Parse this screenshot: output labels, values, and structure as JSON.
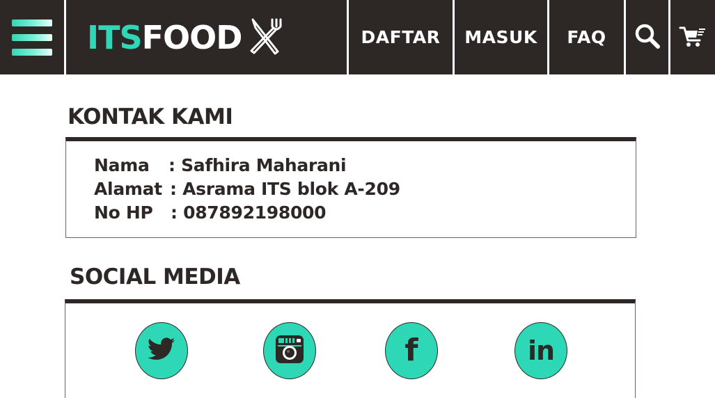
{
  "header": {
    "logo": {
      "part1": "ITS",
      "part2": "FOOD"
    },
    "nav": {
      "register": "DAFTAR",
      "login": "MASUK",
      "faq": "FAQ"
    }
  },
  "contact": {
    "title": "KONTAK KAMI",
    "rows": [
      {
        "label": "Nama",
        "value": ": Safhira Maharani"
      },
      {
        "label": "Alamat",
        "value": ": Asrama ITS blok A-209"
      },
      {
        "label": "No HP",
        "value": ": 087892198000"
      }
    ]
  },
  "social": {
    "title": "SOCIAL MEDIA",
    "facebook_glyph": "f",
    "linkedin_glyph": "in",
    "icons": [
      "twitter-icon",
      "instagram-icon",
      "facebook-icon",
      "linkedin-icon"
    ]
  },
  "colors": {
    "dark": "#2d2826",
    "accent": "#2ed8b6",
    "background": "#ffffff"
  }
}
